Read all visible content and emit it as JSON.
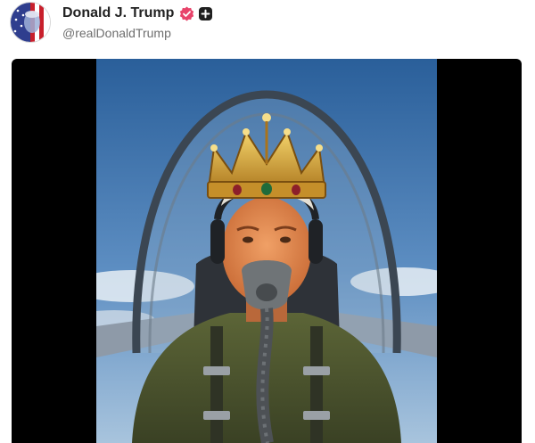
{
  "post": {
    "author": {
      "display_name": "Donald J. Trump",
      "handle": "@realDonaldTrump",
      "verified": true,
      "verified_icon": "verified-badge-icon",
      "extra_badge_icon": "plus-badge-icon",
      "verified_color": "#e8436a"
    },
    "media": {
      "type": "image",
      "background": "#000000"
    }
  }
}
